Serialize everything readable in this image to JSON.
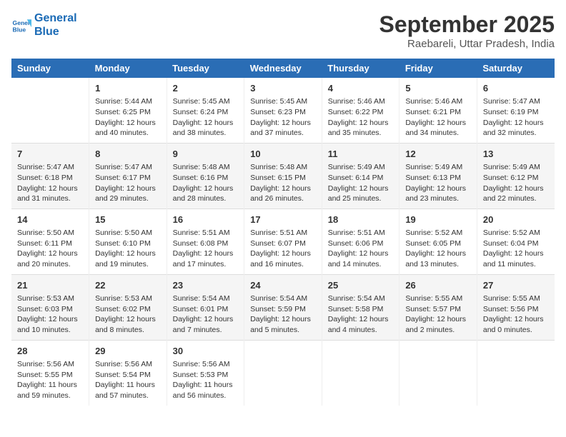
{
  "logo": {
    "line1": "General",
    "line2": "Blue"
  },
  "title": "September 2025",
  "subtitle": "Raebareli, Uttar Pradesh, India",
  "days_header": [
    "Sunday",
    "Monday",
    "Tuesday",
    "Wednesday",
    "Thursday",
    "Friday",
    "Saturday"
  ],
  "weeks": [
    [
      {
        "num": "",
        "info": ""
      },
      {
        "num": "1",
        "info": "Sunrise: 5:44 AM\nSunset: 6:25 PM\nDaylight: 12 hours\nand 40 minutes."
      },
      {
        "num": "2",
        "info": "Sunrise: 5:45 AM\nSunset: 6:24 PM\nDaylight: 12 hours\nand 38 minutes."
      },
      {
        "num": "3",
        "info": "Sunrise: 5:45 AM\nSunset: 6:23 PM\nDaylight: 12 hours\nand 37 minutes."
      },
      {
        "num": "4",
        "info": "Sunrise: 5:46 AM\nSunset: 6:22 PM\nDaylight: 12 hours\nand 35 minutes."
      },
      {
        "num": "5",
        "info": "Sunrise: 5:46 AM\nSunset: 6:21 PM\nDaylight: 12 hours\nand 34 minutes."
      },
      {
        "num": "6",
        "info": "Sunrise: 5:47 AM\nSunset: 6:19 PM\nDaylight: 12 hours\nand 32 minutes."
      }
    ],
    [
      {
        "num": "7",
        "info": "Sunrise: 5:47 AM\nSunset: 6:18 PM\nDaylight: 12 hours\nand 31 minutes."
      },
      {
        "num": "8",
        "info": "Sunrise: 5:47 AM\nSunset: 6:17 PM\nDaylight: 12 hours\nand 29 minutes."
      },
      {
        "num": "9",
        "info": "Sunrise: 5:48 AM\nSunset: 6:16 PM\nDaylight: 12 hours\nand 28 minutes."
      },
      {
        "num": "10",
        "info": "Sunrise: 5:48 AM\nSunset: 6:15 PM\nDaylight: 12 hours\nand 26 minutes."
      },
      {
        "num": "11",
        "info": "Sunrise: 5:49 AM\nSunset: 6:14 PM\nDaylight: 12 hours\nand 25 minutes."
      },
      {
        "num": "12",
        "info": "Sunrise: 5:49 AM\nSunset: 6:13 PM\nDaylight: 12 hours\nand 23 minutes."
      },
      {
        "num": "13",
        "info": "Sunrise: 5:49 AM\nSunset: 6:12 PM\nDaylight: 12 hours\nand 22 minutes."
      }
    ],
    [
      {
        "num": "14",
        "info": "Sunrise: 5:50 AM\nSunset: 6:11 PM\nDaylight: 12 hours\nand 20 minutes."
      },
      {
        "num": "15",
        "info": "Sunrise: 5:50 AM\nSunset: 6:10 PM\nDaylight: 12 hours\nand 19 minutes."
      },
      {
        "num": "16",
        "info": "Sunrise: 5:51 AM\nSunset: 6:08 PM\nDaylight: 12 hours\nand 17 minutes."
      },
      {
        "num": "17",
        "info": "Sunrise: 5:51 AM\nSunset: 6:07 PM\nDaylight: 12 hours\nand 16 minutes."
      },
      {
        "num": "18",
        "info": "Sunrise: 5:51 AM\nSunset: 6:06 PM\nDaylight: 12 hours\nand 14 minutes."
      },
      {
        "num": "19",
        "info": "Sunrise: 5:52 AM\nSunset: 6:05 PM\nDaylight: 12 hours\nand 13 minutes."
      },
      {
        "num": "20",
        "info": "Sunrise: 5:52 AM\nSunset: 6:04 PM\nDaylight: 12 hours\nand 11 minutes."
      }
    ],
    [
      {
        "num": "21",
        "info": "Sunrise: 5:53 AM\nSunset: 6:03 PM\nDaylight: 12 hours\nand 10 minutes."
      },
      {
        "num": "22",
        "info": "Sunrise: 5:53 AM\nSunset: 6:02 PM\nDaylight: 12 hours\nand 8 minutes."
      },
      {
        "num": "23",
        "info": "Sunrise: 5:54 AM\nSunset: 6:01 PM\nDaylight: 12 hours\nand 7 minutes."
      },
      {
        "num": "24",
        "info": "Sunrise: 5:54 AM\nSunset: 5:59 PM\nDaylight: 12 hours\nand 5 minutes."
      },
      {
        "num": "25",
        "info": "Sunrise: 5:54 AM\nSunset: 5:58 PM\nDaylight: 12 hours\nand 4 minutes."
      },
      {
        "num": "26",
        "info": "Sunrise: 5:55 AM\nSunset: 5:57 PM\nDaylight: 12 hours\nand 2 minutes."
      },
      {
        "num": "27",
        "info": "Sunrise: 5:55 AM\nSunset: 5:56 PM\nDaylight: 12 hours\nand 0 minutes."
      }
    ],
    [
      {
        "num": "28",
        "info": "Sunrise: 5:56 AM\nSunset: 5:55 PM\nDaylight: 11 hours\nand 59 minutes."
      },
      {
        "num": "29",
        "info": "Sunrise: 5:56 AM\nSunset: 5:54 PM\nDaylight: 11 hours\nand 57 minutes."
      },
      {
        "num": "30",
        "info": "Sunrise: 5:56 AM\nSunset: 5:53 PM\nDaylight: 11 hours\nand 56 minutes."
      },
      {
        "num": "",
        "info": ""
      },
      {
        "num": "",
        "info": ""
      },
      {
        "num": "",
        "info": ""
      },
      {
        "num": "",
        "info": ""
      }
    ]
  ]
}
